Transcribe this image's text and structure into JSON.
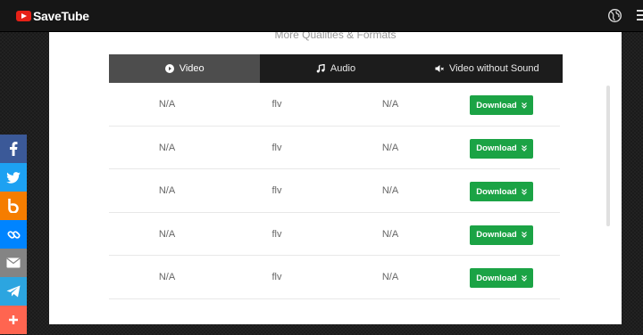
{
  "app": {
    "name": "SaveTube"
  },
  "section": {
    "title": "More Qualities & Formats"
  },
  "tabs": [
    {
      "label": "Video",
      "icon": "play-circle-icon",
      "active": true
    },
    {
      "label": "Audio",
      "icon": "music-note-icon",
      "active": false
    },
    {
      "label": "Video without Sound",
      "icon": "mute-icon",
      "active": false
    }
  ],
  "rows": [
    {
      "quality": "N/A",
      "format": "flv",
      "size": "N/A",
      "action": "Download"
    },
    {
      "quality": "N/A",
      "format": "flv",
      "size": "N/A",
      "action": "Download"
    },
    {
      "quality": "N/A",
      "format": "flv",
      "size": "N/A",
      "action": "Download"
    },
    {
      "quality": "N/A",
      "format": "flv",
      "size": "N/A",
      "action": "Download"
    },
    {
      "quality": "N/A",
      "format": "flv",
      "size": "N/A",
      "action": "Download"
    }
  ],
  "social": [
    {
      "name": "facebook",
      "color": "#3b5998"
    },
    {
      "name": "twitter",
      "color": "#1da1f2"
    },
    {
      "name": "blogger",
      "color": "#f57d00"
    },
    {
      "name": "copy-link",
      "color": "#0084ff"
    },
    {
      "name": "email",
      "color": "#848484"
    },
    {
      "name": "telegram",
      "color": "#2ca5e0"
    },
    {
      "name": "more",
      "color": "#ff6550"
    }
  ],
  "colors": {
    "download": "#1ba345",
    "tabbar": "#1c1c1c",
    "active_tab": "#4d4d4d",
    "brand": "#e62117"
  }
}
